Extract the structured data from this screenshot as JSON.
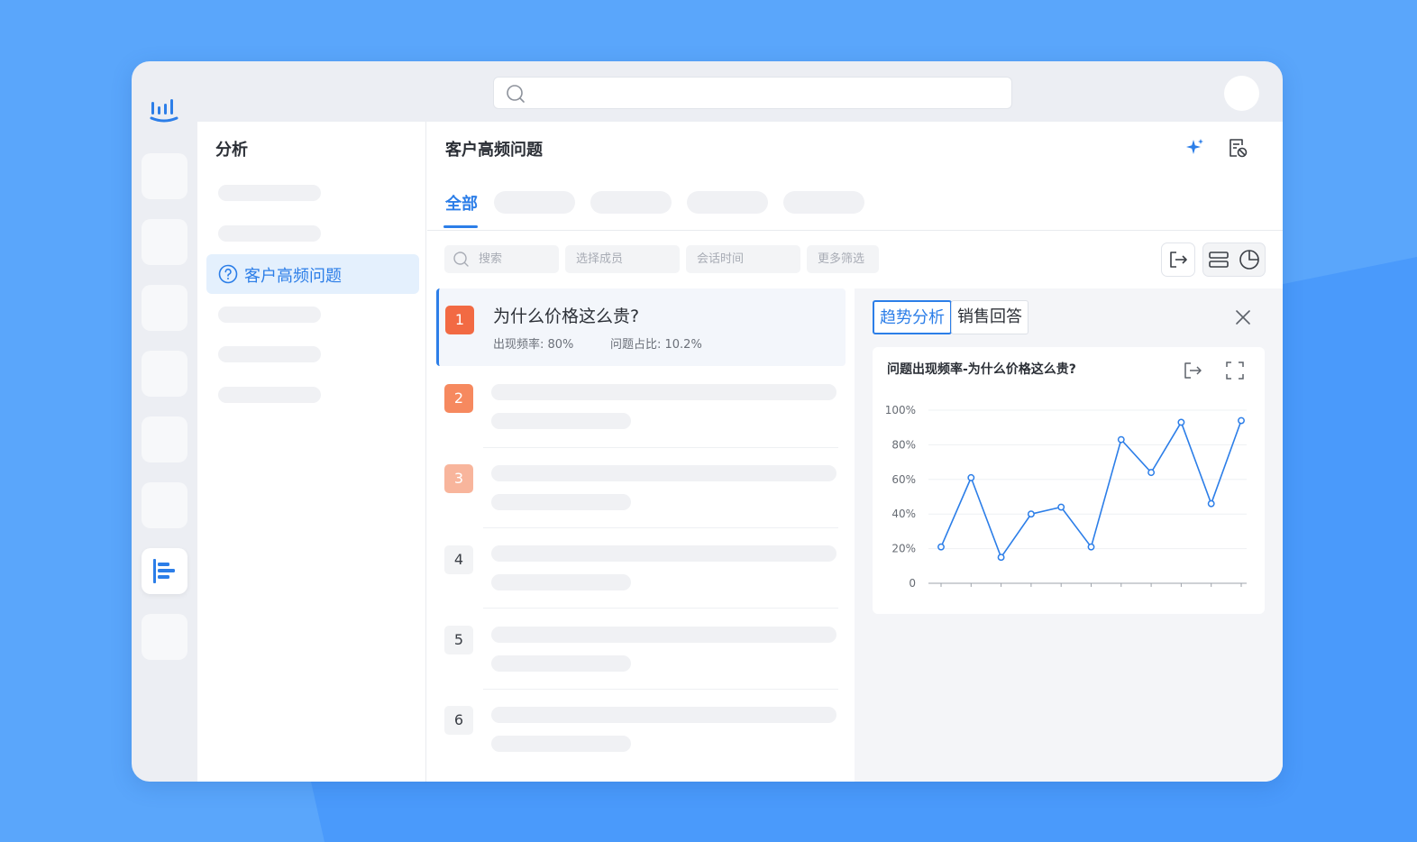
{
  "topbar": {
    "search_placeholder": ""
  },
  "sidebar": {
    "title": "分析",
    "active_item": "客户高频问题"
  },
  "main": {
    "title": "客户高频问题",
    "tabs": [
      {
        "label": "全部",
        "active": true
      }
    ],
    "filters": {
      "search_placeholder": "搜索",
      "member": "选择成员",
      "time": "会话时间",
      "more": "更多筛选"
    },
    "list": [
      {
        "rank": "1",
        "title": "为什么价格这么贵?",
        "frequency": "出现频率: 80%",
        "share": "问题占比: 10.2%",
        "color": "#f26a43"
      },
      {
        "rank": "2",
        "color": "#f6895f"
      },
      {
        "rank": "3",
        "color": "#f8b59c"
      },
      {
        "rank": "4"
      },
      {
        "rank": "5"
      },
      {
        "rank": "6"
      }
    ]
  },
  "panel": {
    "tabs": [
      {
        "label": "趋势分析",
        "active": true
      },
      {
        "label": "销售回答",
        "active": false
      }
    ],
    "card_title": "问题出现频率-为什么价格这么贵?"
  },
  "colors": {
    "accent": "#2c7ee8",
    "background": "#5aa6fb"
  },
  "chart_data": {
    "type": "line",
    "title": "问题出现频率-为什么价格这么贵?",
    "y_ticks": [
      "0",
      "20%",
      "40%",
      "60%",
      "80%",
      "100%"
    ],
    "ylim": [
      0,
      100
    ],
    "grid": true,
    "series": [
      {
        "values": [
          21,
          61,
          15,
          40,
          44,
          21,
          83,
          64,
          93,
          46,
          94
        ]
      }
    ]
  }
}
